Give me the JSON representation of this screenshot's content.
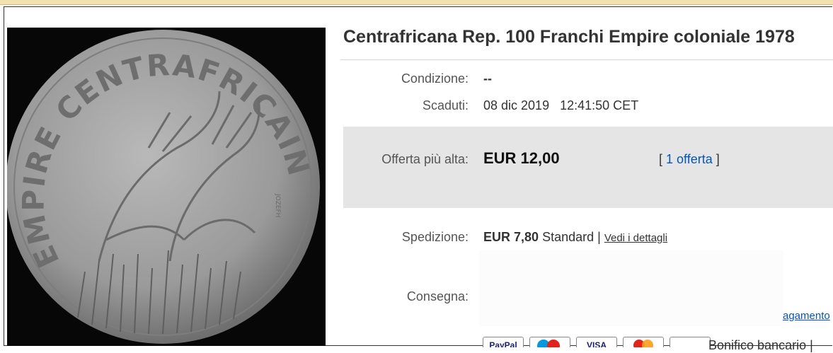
{
  "title": "Centrafricana Rep. 100 Franchi Empire coloniale 1978",
  "photo": {
    "legend": "EMPIRE CENTRAFRICAIN",
    "signature": "JOZEFH"
  },
  "condition": {
    "label": "Condizione:",
    "value": "--"
  },
  "ended": {
    "label": "Scaduti:",
    "date": "08 dic 2019",
    "time": "12:41:50 CET"
  },
  "bid": {
    "label": "Offerta più alta:",
    "price": "EUR 12,00",
    "open": "[",
    "count": "1 offerta",
    "close": "]"
  },
  "shipping": {
    "label": "Spedizione:",
    "price": "EUR 7,80",
    "method": "Standard |",
    "details": "Vedi i dettagli"
  },
  "delivery": {
    "label": "Consegna:"
  },
  "payments": {
    "link": "agamento",
    "methods": [
      "PayPal",
      "Maestro",
      "VISA",
      "MasterCard",
      "Bonifico"
    ],
    "text": "Bonifico bancario |"
  },
  "colors": {
    "link": "#0654ba",
    "bid_bg": "#e5e5e5",
    "topbar": "#f1e2b0"
  }
}
